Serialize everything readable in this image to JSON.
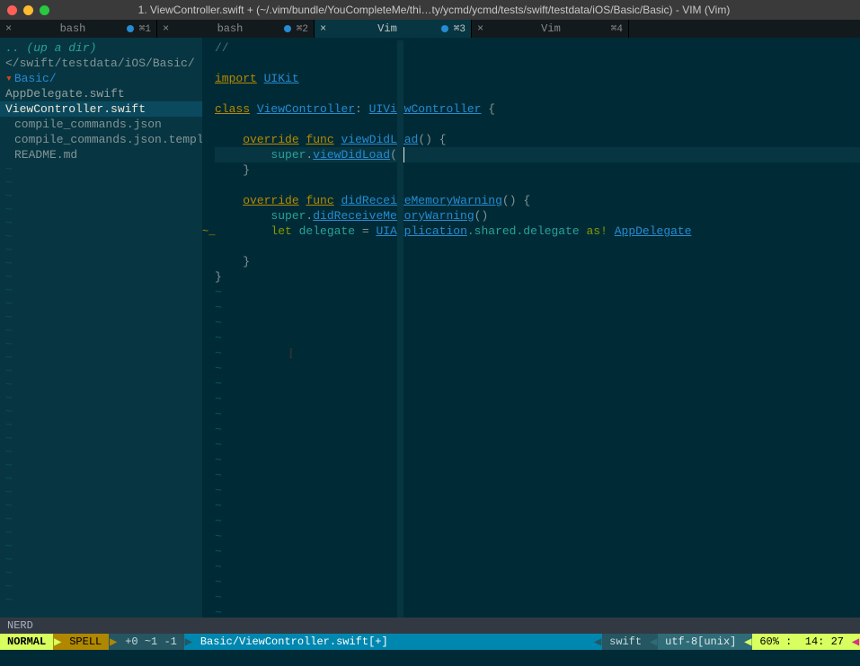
{
  "titlebar": {
    "title": "1. ViewController.swift + (~/.vim/bundle/YouCompleteMe/thi…ty/ycmd/ycmd/tests/swift/testdata/iOS/Basic/Basic) - VIM (Vim)"
  },
  "tabs": [
    {
      "label": "bash",
      "kbd": "⌘1",
      "dot": true,
      "active": false
    },
    {
      "label": "bash",
      "kbd": "⌘2",
      "dot": true,
      "active": false
    },
    {
      "label": "Vim",
      "kbd": "⌘3",
      "dot": true,
      "active": true
    },
    {
      "label": "Vim",
      "kbd": "⌘4",
      "dot": false,
      "active": false
    }
  ],
  "sidebar": {
    "up": ".. (up a dir)",
    "path_trunc": "</swift/testdata/iOS/Basic/",
    "folder": "Basic/",
    "files": [
      {
        "name": "AppDelegate.swift",
        "selected": false
      },
      {
        "name": "ViewController.swift",
        "selected": true
      }
    ],
    "extra_files": [
      "compile_commands.json",
      "compile_commands.json.template",
      "README.md"
    ]
  },
  "code": {
    "lines": [
      {
        "raw": "//",
        "segments": [
          {
            "t": "//",
            "c": "comment"
          }
        ]
      },
      {
        "raw": "",
        "segments": []
      },
      {
        "raw": "import UIKit",
        "segments": [
          {
            "t": "import",
            "c": "kw"
          },
          {
            "t": " ",
            "c": ""
          },
          {
            "t": "UIKit",
            "c": "uikit"
          }
        ]
      },
      {
        "raw": "",
        "segments": []
      },
      {
        "raw": "class ViewController: UIViewController {",
        "segments": [
          {
            "t": "class",
            "c": "kw"
          },
          {
            "t": " ",
            "c": ""
          },
          {
            "t": "ViewController",
            "c": "type"
          },
          {
            "t": ": ",
            "c": "punct"
          },
          {
            "t": "UIViewController",
            "c": "type"
          },
          {
            "t": " {",
            "c": "punct"
          }
        ]
      },
      {
        "raw": "",
        "segments": []
      },
      {
        "raw": "    override func viewDidLoad() {",
        "segments": [
          {
            "t": "    ",
            "c": ""
          },
          {
            "t": "override",
            "c": "func-over"
          },
          {
            "t": " ",
            "c": ""
          },
          {
            "t": "func",
            "c": "kw"
          },
          {
            "t": " ",
            "c": ""
          },
          {
            "t": "viewDidLoad",
            "c": "fn"
          },
          {
            "t": "() {",
            "c": "punct"
          }
        ]
      },
      {
        "raw": "        super.viewDidLoad()",
        "cursor": true,
        "segments": [
          {
            "t": "        super",
            "c": "id"
          },
          {
            "t": ".",
            "c": "punct"
          },
          {
            "t": "viewDidLoad",
            "c": "fn"
          },
          {
            "t": "(",
            "c": "punct"
          },
          {
            "t": ")",
            "c": "punct",
            "cursor_here": true
          }
        ]
      },
      {
        "raw": "    }",
        "segments": [
          {
            "t": "    }",
            "c": "punct"
          }
        ]
      },
      {
        "raw": "",
        "segments": []
      },
      {
        "raw": "    override func didReceiveMemoryWarning() {",
        "segments": [
          {
            "t": "    ",
            "c": ""
          },
          {
            "t": "override",
            "c": "func-over"
          },
          {
            "t": " ",
            "c": ""
          },
          {
            "t": "func",
            "c": "kw"
          },
          {
            "t": " ",
            "c": ""
          },
          {
            "t": "didReceiveMemoryWarning",
            "c": "fn"
          },
          {
            "t": "() {",
            "c": "punct"
          }
        ]
      },
      {
        "raw": "        super.didReceiveMemoryWarning()",
        "segments": [
          {
            "t": "        super",
            "c": "id"
          },
          {
            "t": ".",
            "c": "punct"
          },
          {
            "t": "didReceiveMemoryWarning",
            "c": "fn"
          },
          {
            "t": "()",
            "c": "punct"
          }
        ]
      },
      {
        "raw": "        let delegate = UIApplication.shared.delegate as! AppDelegate",
        "segments": [
          {
            "t": "        ",
            "c": ""
          },
          {
            "t": "let",
            "c": "kw-plain"
          },
          {
            "t": " delegate ",
            "c": "id"
          },
          {
            "t": "= ",
            "c": "punct"
          },
          {
            "t": "UIApplication",
            "c": "type"
          },
          {
            "t": ".shared.delegate ",
            "c": "id"
          },
          {
            "t": "as!",
            "c": "as"
          },
          {
            "t": " ",
            "c": ""
          },
          {
            "t": "AppDelegate",
            "c": "type"
          }
        ],
        "gutter_mark": "~_"
      },
      {
        "raw": "",
        "segments": []
      },
      {
        "raw": "    }",
        "segments": [
          {
            "t": "    }",
            "c": "punct"
          }
        ]
      },
      {
        "raw": "}",
        "segments": [
          {
            "t": "}",
            "c": "punct"
          }
        ]
      }
    ],
    "tilde_count": 23,
    "colmark_col": 27
  },
  "status": {
    "nerd": "NERD",
    "mode": "NORMAL",
    "spell": "SPELL",
    "diff": "+0 ~1 -1",
    "file": "Basic/ViewController.swift[+]",
    "ft": "swift",
    "enc": "utf-8[unix]",
    "percent": "60%",
    "pos": "14: 27"
  }
}
